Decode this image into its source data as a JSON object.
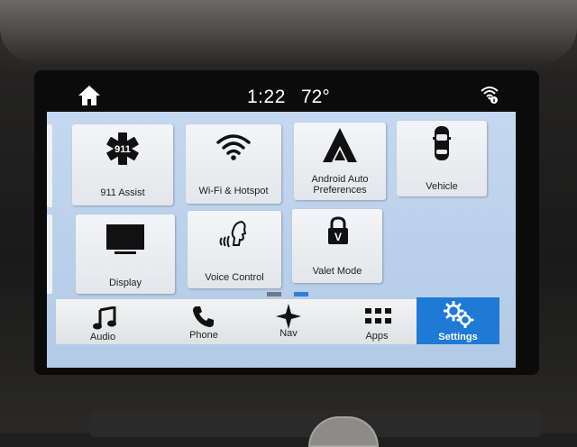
{
  "status": {
    "time": "1:22",
    "temperature": "72°",
    "home_icon": "home-icon",
    "wifi_icon": "wifi-info-icon"
  },
  "tiles": [
    {
      "label": "911 Assist",
      "icon": "star-of-life-911-icon",
      "badge": "911"
    },
    {
      "label": "Wi-Fi & Hotspot",
      "icon": "wifi-icon"
    },
    {
      "label_line1": "Android Auto",
      "label_line2": "Preferences",
      "icon": "android-auto-icon"
    },
    {
      "label": "Vehicle",
      "icon": "car-icon"
    },
    {
      "label": "Display",
      "icon": "monitor-icon"
    },
    {
      "label": "Voice Control",
      "icon": "voice-control-icon"
    },
    {
      "label": "Valet Mode",
      "icon": "lock-icon",
      "badge": "V"
    }
  ],
  "pager": {
    "pages": 2,
    "current": 2
  },
  "nav": [
    {
      "label": "Audio",
      "icon": "music-note-icon"
    },
    {
      "label": "Phone",
      "icon": "phone-icon"
    },
    {
      "label": "Nav",
      "icon": "compass-star-icon"
    },
    {
      "label": "Apps",
      "icon": "apps-grid-icon"
    },
    {
      "label": "Settings",
      "icon": "gears-icon",
      "active": true
    }
  ],
  "colors": {
    "screen_bg": "#c4d8ef",
    "active_tab": "#1f7ad6",
    "pager_active": "#2f7fd6",
    "pager_inactive": "#6e7a87"
  }
}
